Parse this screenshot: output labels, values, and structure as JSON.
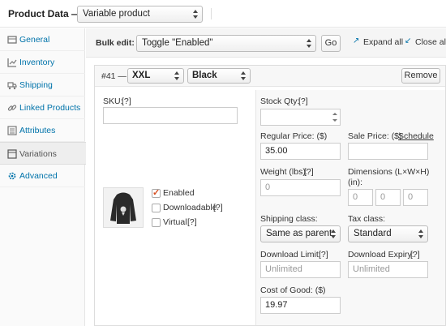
{
  "header": {
    "title": "Product Data —",
    "product_type": "Variable product"
  },
  "sidebar": {
    "items": [
      {
        "label": "General",
        "icon": "wrench-icon"
      },
      {
        "label": "Inventory",
        "icon": "chart-icon"
      },
      {
        "label": "Shipping",
        "icon": "truck-icon"
      },
      {
        "label": "Linked Products",
        "icon": "link-icon"
      },
      {
        "label": "Attributes",
        "icon": "list-icon"
      },
      {
        "label": "Variations",
        "icon": "grid-icon"
      },
      {
        "label": "Advanced",
        "icon": "gear-icon"
      }
    ],
    "active": "Variations"
  },
  "toolbar": {
    "bulk_label": "Bulk edit:",
    "bulk_value": "Toggle \"Enabled\"",
    "go_label": "Go",
    "expand_label": "Expand all",
    "close_label": "Close all"
  },
  "variation": {
    "id_label": "#41 —",
    "size": "XXL",
    "color": "Black",
    "remove_label": "Remove",
    "sku_label": "SKU:",
    "sku_help": "[?]",
    "enabled_label": "Enabled",
    "downloadable_label": "Downloadable",
    "downloadable_help": "[?]",
    "virtual_label": "Virtual",
    "virtual_help": "[?]",
    "stock_label": "Stock Qty:",
    "stock_help": "[?]",
    "regular_price_label": "Regular Price: ($)",
    "regular_price_value": "35.00",
    "sale_price_label": "Sale Price: ($)",
    "schedule_label": "Schedule",
    "weight_label": "Weight (lbs):",
    "weight_help": "[?]",
    "weight_placeholder": "0",
    "dimensions_label": "Dimensions (L×W×H)",
    "dimensions_unit": "(in):",
    "dim_l": "0",
    "dim_w": "0",
    "dim_h": "0",
    "shipping_class_label": "Shipping class:",
    "shipping_class_value": "Same as parent",
    "tax_class_label": "Tax class:",
    "tax_class_value": "Standard",
    "download_limit_label": "Download Limit:",
    "download_limit_help": "[?]",
    "download_limit_placeholder": "Unlimited",
    "download_expiry_label": "Download Expiry:",
    "download_expiry_help": "[?]",
    "download_expiry_placeholder": "Unlimited",
    "cost_label": "Cost of Good: ($)",
    "cost_value": "19.97"
  }
}
